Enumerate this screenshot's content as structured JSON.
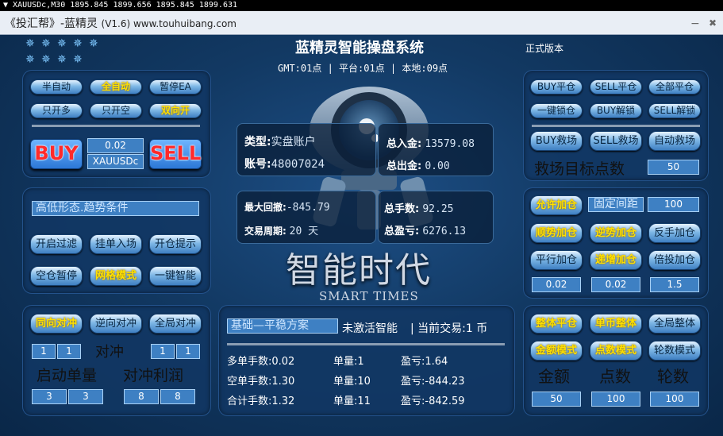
{
  "window": {
    "chart_title": "XAUUSDc,M30  1895.845 1899.656 1895.845 1899.631",
    "app_title": "《投汇帮》-蓝精灵",
    "version": "(V1.6) www.touhuibang.com",
    "minimize": "−",
    "close": "✖"
  },
  "header": {
    "title": "蓝精灵智能操盘系统",
    "edition": "正式版本",
    "time_info": "GMT:01点 | 平台:01点 | 本地:09点"
  },
  "left_top": {
    "btn_semi_auto": "半自动",
    "btn_full_auto": "全自动",
    "btn_pause_ea": "暂停EA",
    "btn_long_only": "只开多",
    "btn_short_only": "只开空",
    "btn_both": "双向开",
    "buy": "BUY",
    "sell": "SELL",
    "lot": "0.02",
    "symbol": "XAUUSDc"
  },
  "left_mid": {
    "condition": "高低形态.趋势条件",
    "btn_filter": "开启过滤",
    "btn_pending": "挂单入场",
    "btn_alert": "开仓提示",
    "btn_flat_pause": "空仓暂停",
    "btn_grid": "网格模式",
    "btn_smart": "一键智能"
  },
  "left_bottom": {
    "btn_same_hedge": "同向对冲",
    "btn_reverse_hedge": "逆向对冲",
    "btn_global_hedge": "全局对冲",
    "hedge_label": "对冲",
    "h1": "1",
    "h2": "1",
    "h3": "1",
    "h4": "1",
    "start_lots_label": "启动单量",
    "hedge_profit_label": "对冲利润",
    "s1": "3",
    "s2": "3",
    "p1": "8",
    "p2": "8"
  },
  "account": {
    "type_label": "类型:",
    "type_value": "实盘账户",
    "acct_label": "账号:",
    "acct_value": "48007024",
    "deposit_label": "总入金:",
    "deposit_value": "13579.08",
    "withdraw_label": "总出金:",
    "withdraw_value": "0.00",
    "dd_label": "最大回撤:",
    "dd_value": "-845.79",
    "cycle_label": "交易周期:",
    "cycle_value": "20 天",
    "lots_label": "总手数:",
    "lots_value": "92.25",
    "profit_label": "总盈亏:",
    "profit_value": "6276.13"
  },
  "slogan": {
    "cn": "智能时代",
    "en": "SMART TIMES"
  },
  "center_bottom": {
    "plan": "基础—平稳方案",
    "status": "未激活智能",
    "current": "当前交易:1 币",
    "r1c1": "多单手数:0.02",
    "r1c2": "单量:1",
    "r1c3": "盈亏:1.64",
    "r2c1": "空单手数:1.30",
    "r2c2": "单量:10",
    "r2c3": "盈亏:-844.23",
    "r3c1": "合计手数:1.32",
    "r3c2": "单量:11",
    "r3c3": "盈亏:-842.59"
  },
  "right_top": {
    "btn_buy_close": "BUY平仓",
    "btn_sell_close": "SELL平仓",
    "btn_all_close": "全部平仓",
    "btn_lock": "一键锁仓",
    "btn_buy_unlock": "BUY解锁",
    "btn_sell_unlock": "SELL解锁",
    "btn_buy_rescue": "BUY救场",
    "btn_sell_rescue": "SELL救场",
    "btn_auto_rescue": "自动救场",
    "rescue_label": "救场目标点数",
    "rescue_value": "50"
  },
  "right_mid": {
    "btn_allow_add": "允许加仓",
    "fixed_interval": "固定间距",
    "interval_value": "100",
    "btn_trend_add": "顺势加仓",
    "btn_counter_add": "逆势加仓",
    "btn_reverse_add": "反手加仓",
    "btn_flat_add": "平行加仓",
    "btn_inc_add": "递增加仓",
    "btn_multi_add": "倍投加仓",
    "v1": "0.02",
    "v2": "0.02",
    "v3": "1.5"
  },
  "right_bottom": {
    "btn_whole_close": "整体平仓",
    "btn_single_whole": "单币整体",
    "btn_global_whole": "全局整体",
    "btn_amount_mode": "金额模式",
    "btn_points_mode": "点数模式",
    "btn_rounds_mode": "轮数模式",
    "amount_label": "金额",
    "points_label": "点数",
    "rounds_label": "轮数",
    "amount_value": "50",
    "points_value": "100",
    "rounds_value": "100"
  }
}
